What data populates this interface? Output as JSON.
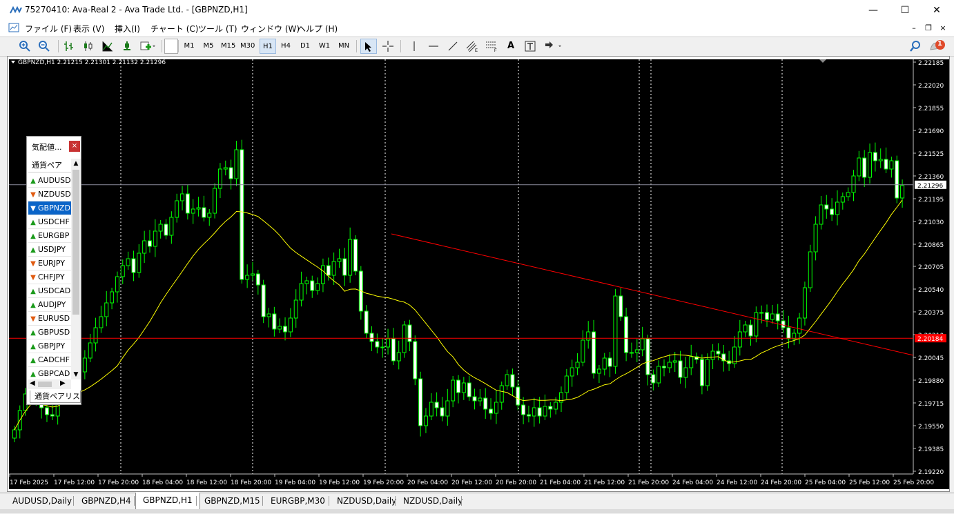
{
  "window": {
    "title": "75270410: Ava-Real 2 - Ava Trade Ltd. - [GBPNZD,H1]",
    "minimize": "—",
    "maximize": "☐",
    "close": "✕"
  },
  "menu": [
    "ファイル (F)",
    "表示 (V)",
    "挿入(I)",
    "チャート (C)",
    "ツール (T)",
    "ウィンドウ (W)",
    "ヘルプ (H)"
  ],
  "mdi": {
    "minimize": "–",
    "restore": "❐",
    "close": "×"
  },
  "toolbar": {
    "timeframes": [
      "M1",
      "M5",
      "M15",
      "M30",
      "H1",
      "H4",
      "D1",
      "W1",
      "MN"
    ],
    "active_timeframe": "H1",
    "text_tool": "A",
    "notification_count": "1"
  },
  "chart_data": {
    "type": "candlestick",
    "header": "GBPNZD,H1  2.21215 2.21301 2.21132 2.21296",
    "bg_color": "#000000",
    "bull_color": "#00ff00",
    "ma_color": "#ffff00",
    "trend_color": "#ff0000",
    "y_ticks": [
      "2.22185",
      "2.22020",
      "2.21855",
      "2.21690",
      "2.21525",
      "2.21360",
      "2.21195",
      "2.21030",
      "2.20865",
      "2.20705",
      "2.20540",
      "2.20375",
      "2.20210",
      "2.20045",
      "2.19880",
      "2.19715",
      "2.19550",
      "2.19385",
      "2.19220"
    ],
    "ylim": [
      2.1922,
      2.22185
    ],
    "x_ticks": [
      "17 Feb 2025",
      "17 Feb 12:00",
      "17 Feb 20:00",
      "18 Feb 04:00",
      "18 Feb 12:00",
      "18 Feb 20:00",
      "19 Feb 04:00",
      "19 Feb 12:00",
      "19 Feb 20:00",
      "20 Feb 04:00",
      "20 Feb 12:00",
      "20 Feb 20:00",
      "21 Feb 04:00",
      "21 Feb 12:00",
      "21 Feb 20:00",
      "24 Feb 04:00",
      "24 Feb 12:00",
      "24 Feb 20:00",
      "25 Feb 04:00",
      "25 Feb 12:00",
      "25 Feb 20:00"
    ],
    "current_price": "2.21296",
    "horizontal_line_price": "2.20184",
    "trend_line": {
      "from_price": 2.2094,
      "to_price": 2.2006
    },
    "closes": [
      2.1952,
      2.1966,
      2.1978,
      2.1985,
      2.1974,
      2.1968,
      2.1963,
      2.1962,
      2.1975,
      2.1992,
      2.2008,
      2.2012,
      2.1994,
      2.2004,
      2.2015,
      2.2026,
      2.2034,
      2.2044,
      2.2052,
      2.2063,
      2.2071,
      2.2076,
      2.2066,
      2.208,
      2.2089,
      2.2085,
      2.2096,
      2.2101,
      2.2093,
      2.2106,
      2.2118,
      2.2123,
      2.2109,
      2.2112,
      2.2113,
      2.2106,
      2.2109,
      2.2127,
      2.2141,
      2.2142,
      2.2134,
      2.2155,
      2.2061,
      2.2064,
      2.2065,
      2.2057,
      2.2034,
      2.2036,
      2.2025,
      2.2027,
      2.2023,
      2.2033,
      2.2046,
      2.2058,
      2.206,
      2.2053,
      2.2058,
      2.2071,
      2.2064,
      2.2074,
      2.2076,
      2.2064,
      2.209,
      2.2067,
      2.2038,
      2.2022,
      2.2016,
      2.2012,
      2.2012,
      2.2018,
      2.2002,
      2.2008,
      2.2028,
      2.2016,
      2.1989,
      2.1955,
      2.1962,
      2.1972,
      2.1968,
      2.1962,
      2.1973,
      2.1988,
      2.1979,
      2.1986,
      2.1976,
      2.1973,
      2.1975,
      2.1967,
      2.1964,
      2.1972,
      2.1984,
      2.1992,
      2.1983,
      2.197,
      2.1963,
      2.1962,
      2.1968,
      2.1962,
      2.1969,
      2.1967,
      2.1972,
      2.1979,
      2.1991,
      2.1997,
      2.2001,
      2.2017,
      2.2023,
      2.1993,
      2.1996,
      2.2004,
      2.1998,
      2.2049,
      2.2034,
      2.2008,
      2.2008,
      2.201,
      2.2018,
      2.1992,
      2.1986,
      2.1998,
      2.1997,
      2.2001,
      2.2002,
      2.199,
      2.1997,
      2.2005,
      2.2003,
      2.1984,
      2.2003,
      2.2009,
      2.2007,
      2.2002,
      2.2,
      2.2012,
      2.2023,
      2.2028,
      2.202,
      2.2037,
      2.2037,
      2.2032,
      2.2036,
      2.2031,
      2.2026,
      2.2018,
      2.2022,
      2.2033,
      2.2055,
      2.2081,
      2.2101,
      2.2115,
      2.2112,
      2.2108,
      2.2117,
      2.2121,
      2.2124,
      2.2136,
      2.2149,
      2.2135,
      2.2153,
      2.2147,
      2.2148,
      2.2141,
      2.2147,
      2.212,
      2.2129
    ]
  },
  "market_watch": {
    "title": "気配値...",
    "close": "×",
    "column": "通貨ペア",
    "items": [
      {
        "symbol": "AUDUSD",
        "dir": "up"
      },
      {
        "symbol": "NZDUSD",
        "dir": "down"
      },
      {
        "symbol": "GBPNZD",
        "dir": "down",
        "selected": true
      },
      {
        "symbol": "USDCHF",
        "dir": "up"
      },
      {
        "symbol": "EURGBP",
        "dir": "up"
      },
      {
        "symbol": "USDJPY",
        "dir": "up"
      },
      {
        "symbol": "EURJPY",
        "dir": "down"
      },
      {
        "symbol": "CHFJPY",
        "dir": "down"
      },
      {
        "symbol": "USDCAD",
        "dir": "up"
      },
      {
        "symbol": "AUDJPY",
        "dir": "up"
      },
      {
        "symbol": "EURUSD",
        "dir": "down"
      },
      {
        "symbol": "GBPUSD",
        "dir": "up"
      },
      {
        "symbol": "GBPJPY",
        "dir": "up"
      },
      {
        "symbol": "CADCHF",
        "dir": "up"
      },
      {
        "symbol": "GBPCAD",
        "dir": "up"
      }
    ],
    "tab": "通貨ペアリスト"
  },
  "chart_tabs": [
    "AUDUSD,Daily",
    "GBPNZD,H4",
    "GBPNZD,H1",
    "GBPNZD,M15",
    "EURGBP,M30",
    "NZDUSD,Daily",
    "NZDUSD,Daily"
  ],
  "active_tab": "GBPNZD,H1"
}
